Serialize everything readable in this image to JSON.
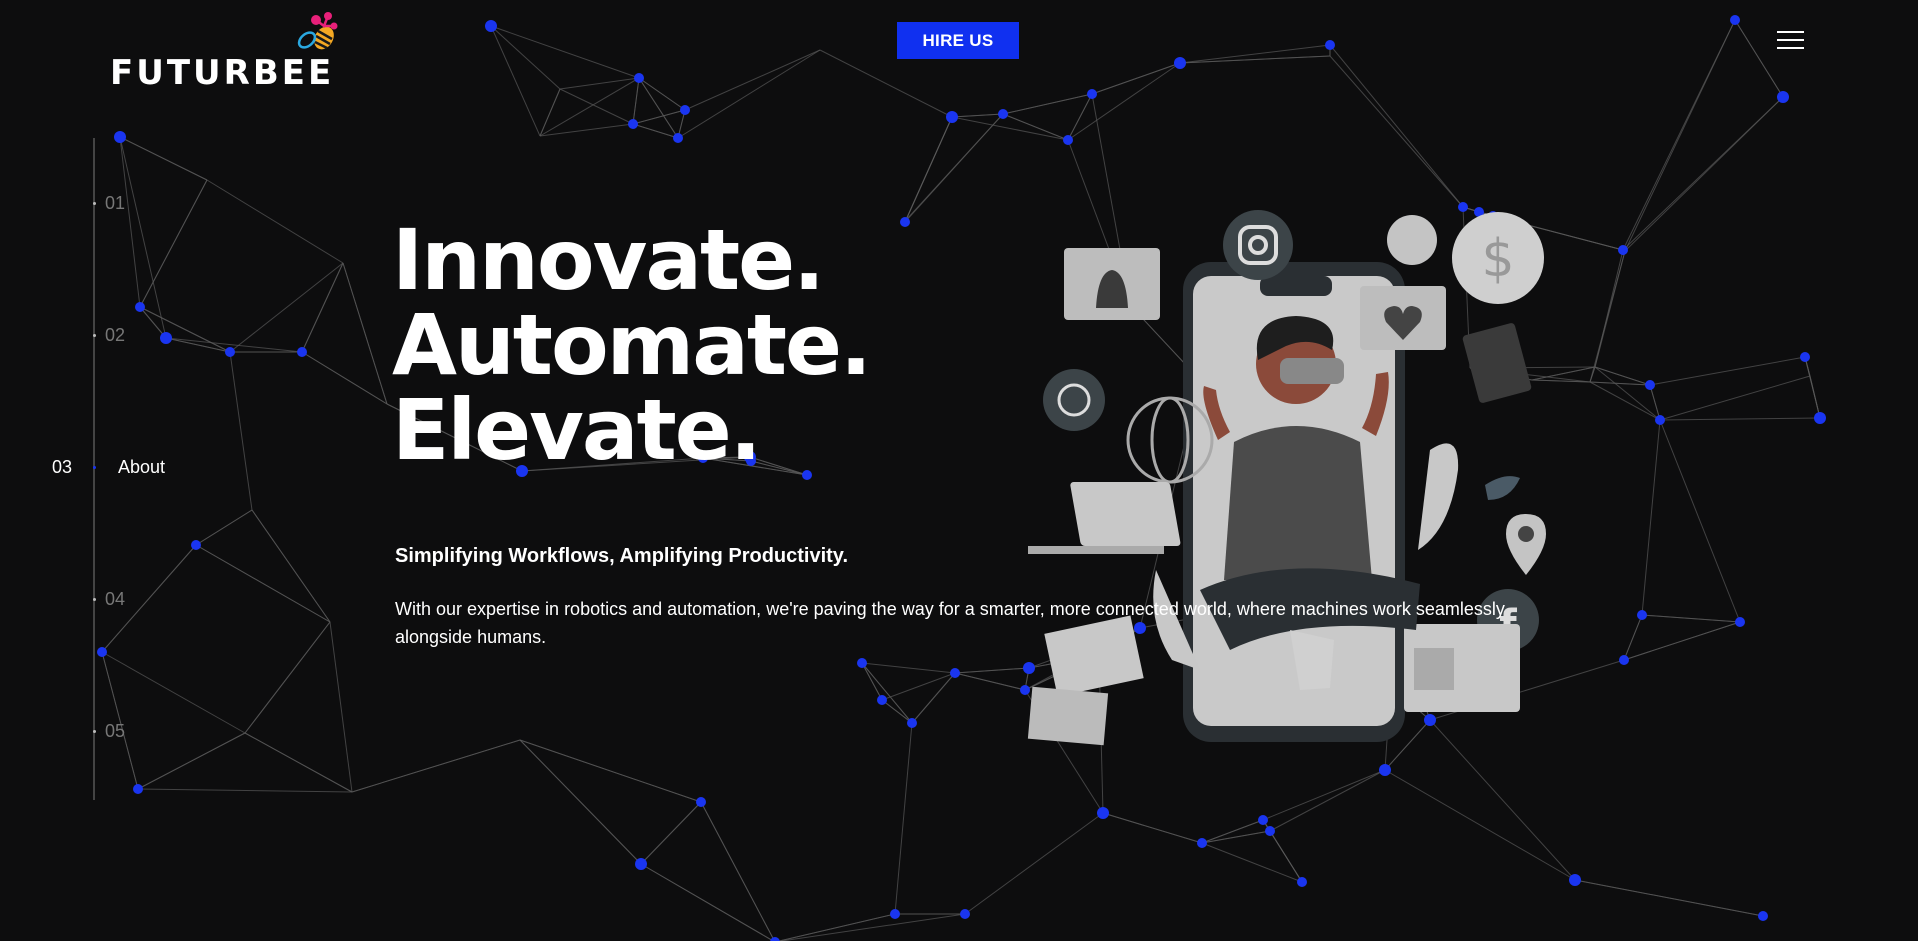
{
  "brand": {
    "name": "FUTURBEE",
    "logo_icon": "bee-icon",
    "colors": {
      "accent": "#1030f0",
      "background": "#0d0d0e",
      "node": "#1a35f0"
    }
  },
  "header": {
    "hire_label": "HIRE US",
    "menu_icon": "hamburger-menu-icon"
  },
  "side_nav": {
    "items": [
      {
        "number": "01",
        "label": ""
      },
      {
        "number": "02",
        "label": ""
      },
      {
        "number": "03",
        "label": "About"
      },
      {
        "number": "04",
        "label": ""
      },
      {
        "number": "05",
        "label": ""
      }
    ],
    "active_index": 2
  },
  "hero": {
    "lines": [
      "Innovate.",
      "Automate.",
      "Elevate."
    ],
    "tagline": "Simplifying Workflows, Amplifying Productivity.",
    "description": "With our expertise in robotics and automation, we're paving the way for a smarter, more connected world, where machines work seamlessly alongside humans."
  },
  "illustration": {
    "subject": "person-with-vr-headset-phone-icon",
    "icons": [
      "instagram-icon",
      "bell-icon",
      "dollar-coin-icon",
      "heart-icon",
      "whatsapp-icon",
      "globe-icon",
      "document-icon",
      "twitter-icon",
      "laptop-icon",
      "location-pin-icon",
      "facebook-icon",
      "image-icon",
      "browser-window-icon"
    ]
  }
}
